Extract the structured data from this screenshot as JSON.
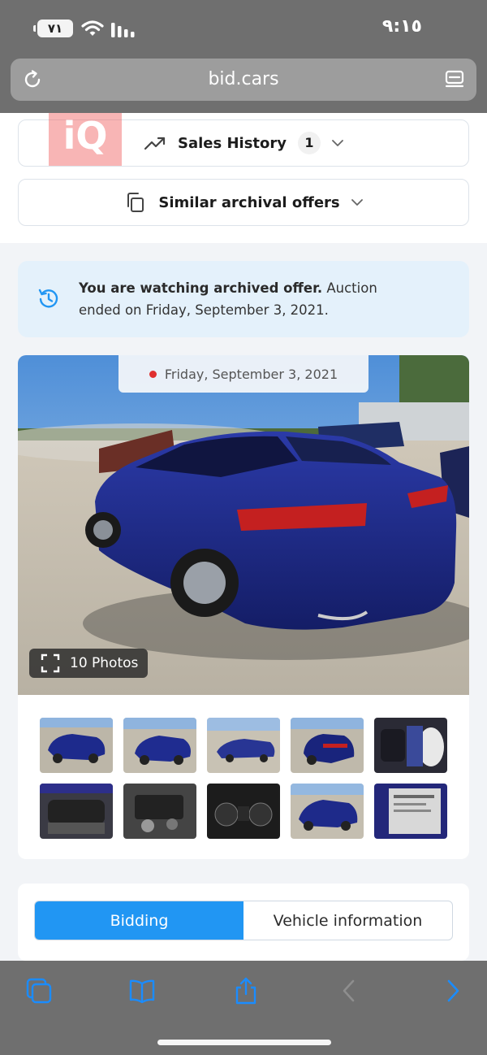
{
  "status_bar": {
    "time": "٩:١٥",
    "battery": "٧١"
  },
  "browser": {
    "url": "bid.cars"
  },
  "logo": {
    "text": "iQ"
  },
  "sales_history": {
    "label": "Sales History",
    "count": "1"
  },
  "similar_offers": {
    "label": "Similar archival offers"
  },
  "notice": {
    "bold": "You are watching archived offer.",
    "rest": " Auction ended on Friday, September 3, 2021."
  },
  "gallery": {
    "date": "Friday, September 3, 2021",
    "photos_label": "10 Photos",
    "thumbnails": [
      "front-left",
      "front-right",
      "side-left",
      "rear",
      "interior-airbag",
      "rear-seats",
      "engine",
      "gauges",
      "front-alt",
      "door-label"
    ]
  },
  "tabs": {
    "bidding": "Bidding",
    "vehicle_info": "Vehicle information",
    "active": "bidding"
  },
  "colors": {
    "accent": "#2196f3",
    "notice_bg": "#e4f1fb",
    "car_blue": "#1d2a8c",
    "chrome_gray": "#6f6f6f"
  }
}
